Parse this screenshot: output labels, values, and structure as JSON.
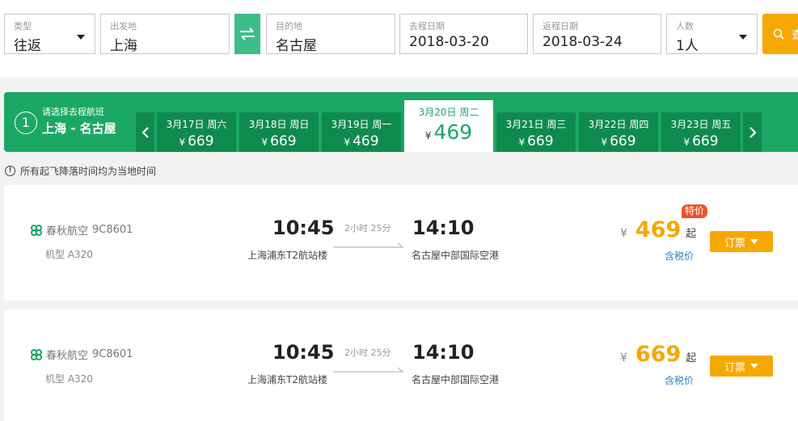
{
  "search": {
    "type_label": "类型",
    "type_value": "往返",
    "from_label": "出发地",
    "from_value": "上海",
    "to_label": "目的地",
    "to_value": "名古屋",
    "depart_label": "去程日期",
    "depart_value": "2018-03-20",
    "return_label": "返程日期",
    "return_value": "2018-03-24",
    "people_label": "人数",
    "people_value": "1人",
    "search_button_label": "查"
  },
  "date_strip": {
    "step_number": "1",
    "hint": "请选择去程航班",
    "route": "上海 - 名古屋",
    "currency": "¥",
    "days": [
      {
        "label": "3月17日 周六",
        "price": "669",
        "active": false
      },
      {
        "label": "3月18日 周日",
        "price": "669",
        "active": false
      },
      {
        "label": "3月19日 周一",
        "price": "469",
        "active": false
      },
      {
        "label": "3月20日 周二",
        "price": "469",
        "active": true
      },
      {
        "label": "3月21日 周三",
        "price": "669",
        "active": false
      },
      {
        "label": "3月22日 周四",
        "price": "669",
        "active": false
      },
      {
        "label": "3月23日 周五",
        "price": "669",
        "active": false
      }
    ]
  },
  "notice": {
    "icon": "!",
    "text": "所有起飞降落时间均为当地时间"
  },
  "flights": [
    {
      "airline": "春秋航空",
      "flight_no": "9C8601",
      "model": "机型 A320",
      "dep_time": "10:45",
      "dep_airport": "上海浦东T2航站楼",
      "duration": "2小时 25分",
      "arr_time": "14:10",
      "arr_airport": "名古屋中部国际空港",
      "currency": "¥",
      "price": "469",
      "price_suffix": "起",
      "tag": "特价",
      "tax": "含税价",
      "book_label": "订票"
    },
    {
      "airline": "春秋航空",
      "flight_no": "9C8601",
      "model": "机型 A320",
      "dep_time": "10:45",
      "dep_airport": "上海浦东T2航站楼",
      "duration": "2小时 25分",
      "arr_time": "14:10",
      "arr_airport": "名古屋中部国际空港",
      "currency": "¥",
      "price": "669",
      "price_suffix": "起",
      "tag": "",
      "tax": "含税价",
      "book_label": "订票"
    }
  ],
  "colors": {
    "brand_green": "#1ba864",
    "dark_green": "#0f8a4f",
    "swap_green": "#3dbd8a",
    "accent_orange": "#f5a800",
    "tag_red": "#e8542c",
    "link_blue": "#2c7dc7"
  },
  "icons": {
    "swap": "swap-arrows-icon",
    "search": "search-icon",
    "prev": "chevron-left-icon",
    "next": "chevron-right-icon",
    "airline_logo": "spring-airlines-logo-icon",
    "notice": "info-circle-icon"
  }
}
